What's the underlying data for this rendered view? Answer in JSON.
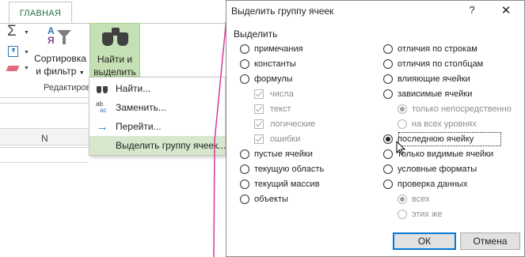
{
  "ribbon": {
    "tab_home": "ГЛАВНАЯ",
    "sort_label_1": "Сортировка",
    "sort_label_2": "и фильтр",
    "find_label_1": "Найти и",
    "find_label_2": "выделить",
    "group_label": "Редактирова"
  },
  "menu": {
    "items": [
      {
        "label": "Найти...",
        "icon": "binoculars-icon"
      },
      {
        "label": "Заменить...",
        "icon": "replace-icon"
      },
      {
        "label": "Перейти...",
        "icon": "arrow-right-icon"
      },
      {
        "label": "Выделить группу ячеек...",
        "icon": "none"
      }
    ]
  },
  "sheet": {
    "column_n": "N"
  },
  "dialog": {
    "title": "Выделить группу ячеек",
    "help": "?",
    "close": "✕",
    "section": "Выделить",
    "left_options": [
      {
        "label": "примечания",
        "checked": false
      },
      {
        "label": "константы",
        "checked": false
      },
      {
        "label": "формулы",
        "checked": false
      },
      {
        "label": "числа",
        "type": "checkbox",
        "disabled": true
      },
      {
        "label": "текст",
        "type": "checkbox",
        "disabled": true
      },
      {
        "label": "логические",
        "type": "checkbox",
        "disabled": true
      },
      {
        "label": "ошибки",
        "type": "checkbox",
        "disabled": true
      },
      {
        "label": "пустые ячейки",
        "checked": false
      },
      {
        "label": "текущую область",
        "checked": false
      },
      {
        "label": "текущий массив",
        "checked": false
      },
      {
        "label": "объекты",
        "checked": false
      }
    ],
    "right_options": [
      {
        "label": "отличия по строкам",
        "checked": false
      },
      {
        "label": "отличия по столбцам",
        "checked": false
      },
      {
        "label": "влияющие ячейки",
        "checked": false
      },
      {
        "label": "зависимые ячейки",
        "checked": false
      },
      {
        "label": "только непосредственно",
        "checked": true,
        "disabled": true
      },
      {
        "label": "на всех уровнях",
        "checked": false,
        "disabled": true
      },
      {
        "label": "последнюю ячейку",
        "checked": true
      },
      {
        "label": "только видимые ячейки",
        "checked": false
      },
      {
        "label": "условные форматы",
        "checked": false
      },
      {
        "label": "проверка данных",
        "checked": false
      },
      {
        "label": "всех",
        "checked": true,
        "disabled": true
      },
      {
        "label": "этих же",
        "checked": false,
        "disabled": true
      }
    ],
    "ok": "ОК",
    "cancel": "Отмена"
  },
  "colors": {
    "accent_green": "#217346",
    "highlight": "#c5e0b4",
    "pink_connector": "#d63a9a"
  }
}
